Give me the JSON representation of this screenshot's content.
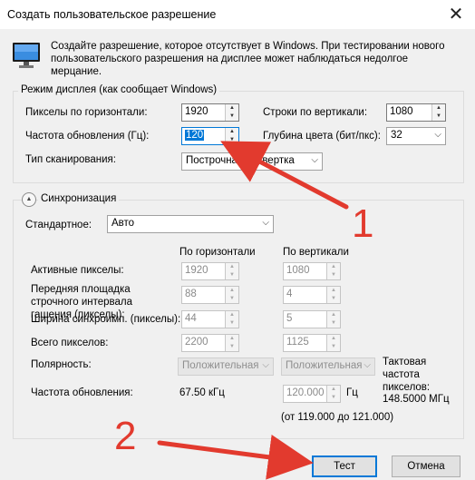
{
  "window": {
    "title": "Создать пользовательское разрешение",
    "close_glyph": "✕"
  },
  "info": {
    "icon": "monitor-icon",
    "text": "Создайте разрешение, которое отсутствует в Windows. При тестировании нового пользовательского разрешения на дисплее может наблюдаться недолгое мерцание."
  },
  "display_mode": {
    "group_title": "Режим дисплея (как сообщает Windows)",
    "hpixels_label": "Пикселы по горизонтали:",
    "hpixels_value": "1920",
    "vlines_label": "Строки по вертикали:",
    "vlines_value": "1080",
    "refresh_label": "Частота обновления (Гц):",
    "refresh_value": "120",
    "depth_label": "Глубина цвета (бит/пкс):",
    "depth_value": "32",
    "scan_label": "Тип сканирования:",
    "scan_value": "Построчная развертка"
  },
  "sync": {
    "group_title": "Синхронизация",
    "standard_label": "Стандартное:",
    "standard_value": "Авто",
    "col_horizontal": "По горизонтали",
    "col_vertical": "По вертикали",
    "rows": [
      {
        "label": "Активные пикселы:",
        "h": "1920",
        "v": "1080"
      },
      {
        "label": "Передняя площадка строчного интервала гашения (пикселы):",
        "h": "88",
        "v": "4"
      },
      {
        "label": "Ширина синхроимп. (пикселы):",
        "h": "44",
        "v": "5"
      },
      {
        "label": "Всего пикселов:",
        "h": "2200",
        "v": "1125"
      }
    ],
    "polarity_label": "Полярность:",
    "polarity_h": "Положительная",
    "polarity_v": "Положительная",
    "refresh_label": "Частота обновления:",
    "refresh_value": "67.50 кГц",
    "refresh_hz_value": "120.000",
    "refresh_hz_unit": "Гц",
    "range_text": "(от 119.000 до 121.000)",
    "pixel_clock_label": "Тактовая частота пикселов:",
    "pixel_clock_value": "148.5000 МГц"
  },
  "buttons": {
    "test": "Тест",
    "cancel": "Отмена"
  },
  "annotations": {
    "one": "1",
    "two": "2",
    "color": "#e23a2e"
  },
  "colors": {
    "accent": "#0078d7",
    "window_bg": "#f0f0f0"
  }
}
